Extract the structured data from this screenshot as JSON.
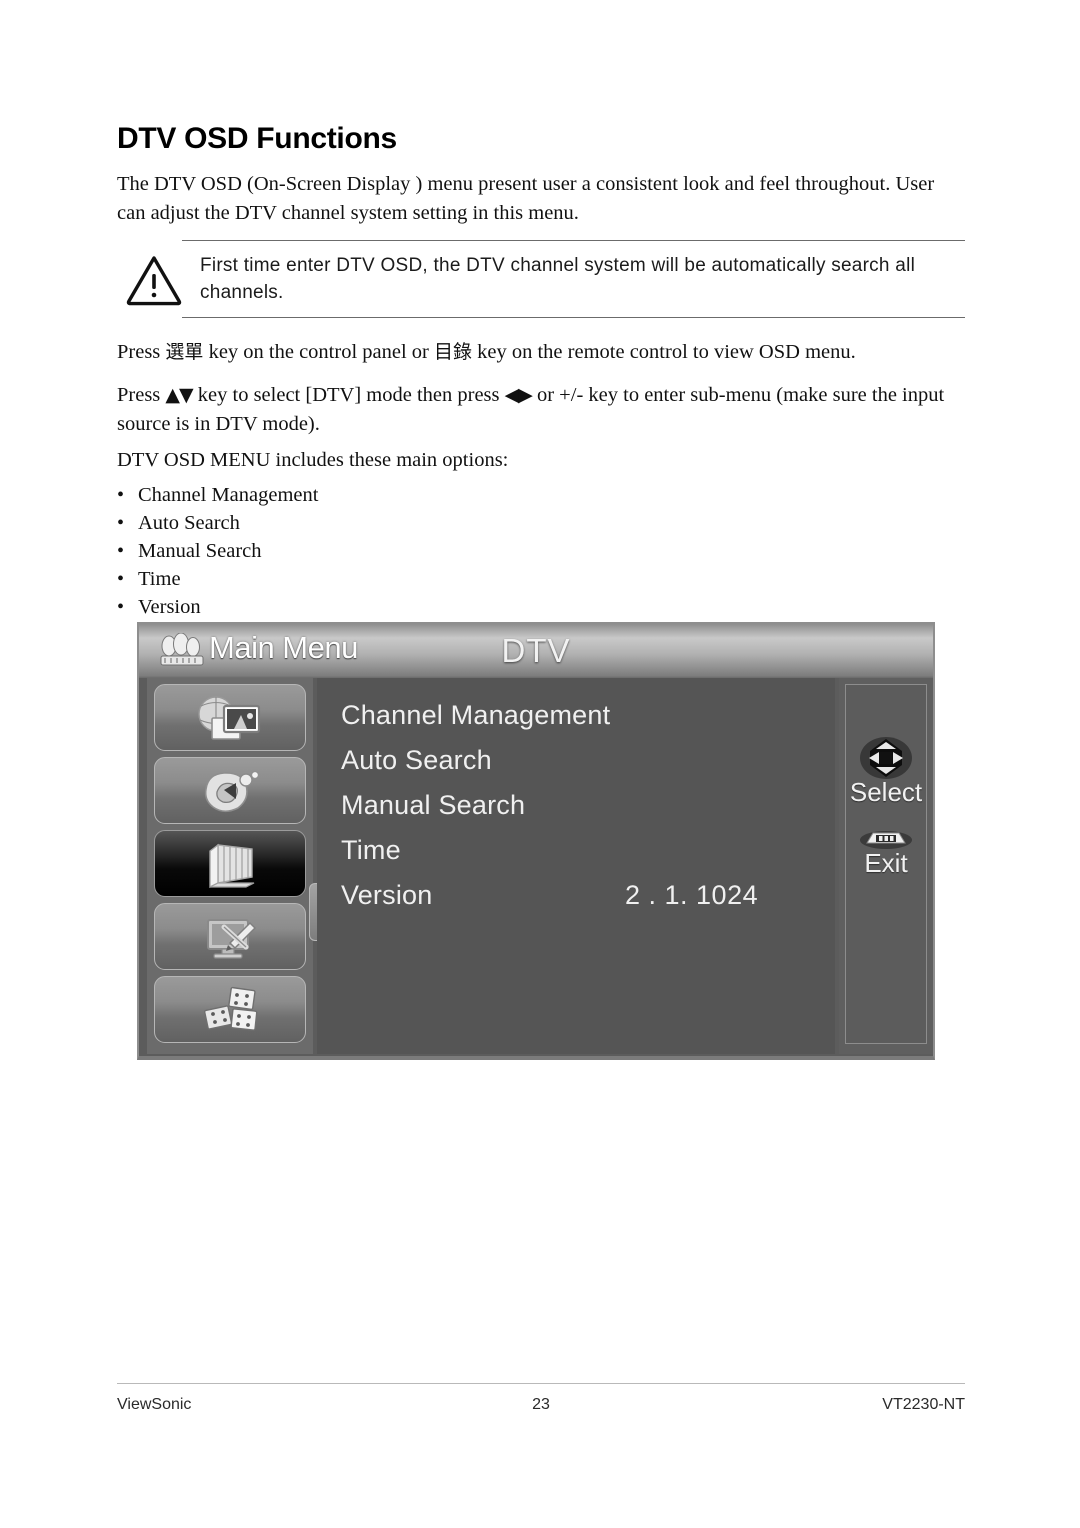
{
  "document": {
    "title": "DTV OSD Functions",
    "intro": "The DTV OSD (On-Screen Display ) menu present user a consistent look and feel throughout. User can adjust the DTV channel system setting in this menu.",
    "note": {
      "icon": "warning-triangle-icon",
      "text": "First time enter DTV OSD, the DTV channel system will be automatically search all channels."
    },
    "instructions": {
      "press_menu_pre": "Press ",
      "press_menu_cjk1": "選單",
      "press_menu_mid": " key on the control panel or ",
      "press_menu_cjk2": "目錄",
      "press_menu_post": " key on the remote control to view OSD menu.",
      "press_nav_pre": "Press ",
      "press_nav_updown": "▲▼",
      "press_nav_mid": " key to select [DTV] mode then press ",
      "press_nav_leftright": "◀▶",
      "press_nav_post": " or +/- key to enter sub-menu (make sure the input source is in DTV mode)."
    },
    "list_intro": "DTV OSD MENU includes these main options:",
    "bullet_char": "•",
    "options": [
      "Channel Management",
      "Auto Search",
      "Manual Search",
      "Time",
      "Version"
    ]
  },
  "osd": {
    "header": {
      "icon": "main-menu-icon",
      "title": "Main Menu",
      "mode": "DTV"
    },
    "sidebar": [
      {
        "icon": "picture-settings-icon",
        "selected": false
      },
      {
        "icon": "audio-settings-icon",
        "selected": false
      },
      {
        "icon": "dtv-settings-icon",
        "selected": true
      },
      {
        "icon": "setup-tools-icon",
        "selected": false
      },
      {
        "icon": "features-blocks-icon",
        "selected": false
      }
    ],
    "navpad": {
      "icon": "nav-arrows-icon",
      "up": "▲",
      "right": "▶",
      "down": "▼"
    },
    "menu_items": [
      {
        "label": "Channel Management",
        "value": ""
      },
      {
        "label": "Auto Search",
        "value": ""
      },
      {
        "label": "Manual Search",
        "value": ""
      },
      {
        "label": "Time",
        "value": ""
      },
      {
        "label": "Version",
        "value": "2 . 1. 1024"
      }
    ],
    "right_panel": {
      "select_icon": "dpad-select-icon",
      "select_label": "Select",
      "exit_icon": "exit-button-icon",
      "exit_label": "Exit"
    },
    "colors": {
      "panel_bg": "#5c5c5c",
      "content_bg": "#555555",
      "header_light": "#c9c9c9",
      "selected_btn": "#000000",
      "text": "#f0f0f0"
    }
  },
  "footer": {
    "brand": "ViewSonic",
    "page_number": "23",
    "model": "VT2230-NT"
  }
}
